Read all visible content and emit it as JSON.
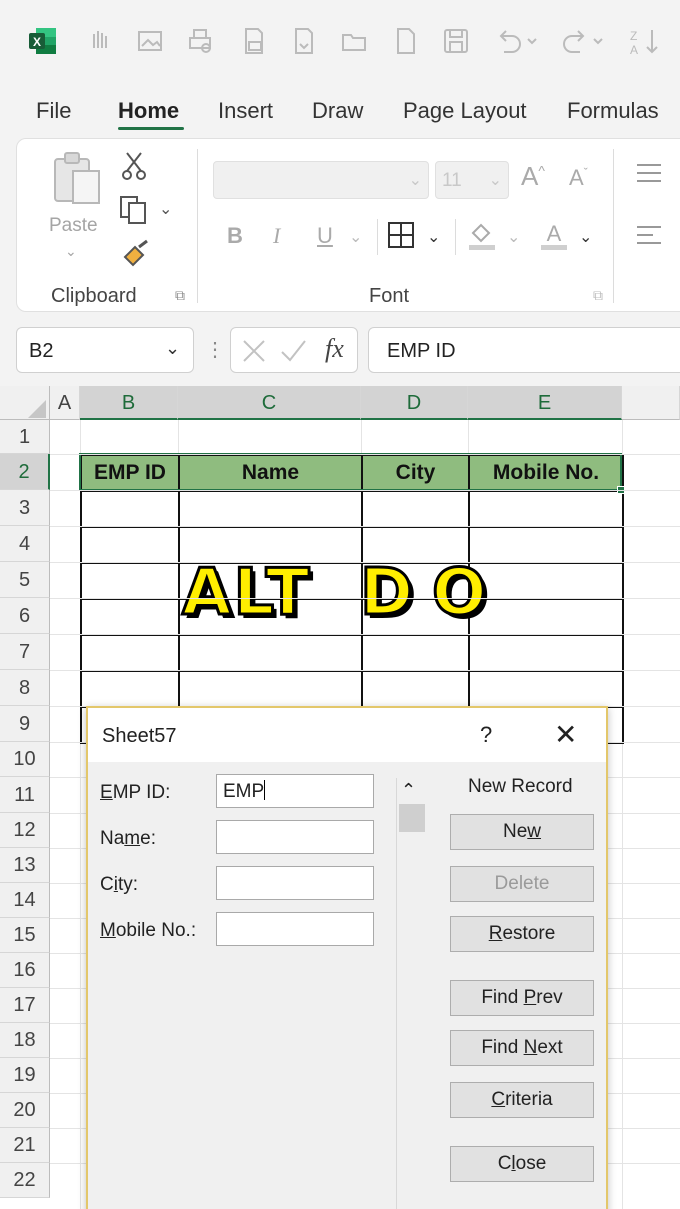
{
  "qat": {
    "icons": [
      "excel-logo",
      "touch-mode-icon",
      "image-icon",
      "print-preview-icon",
      "print-icon",
      "save-as-icon",
      "open-icon",
      "new-icon",
      "save-icon",
      "undo-icon",
      "redo-icon",
      "sort-icon"
    ]
  },
  "tabs": [
    "File",
    "Home",
    "Insert",
    "Draw",
    "Page Layout",
    "Formulas"
  ],
  "active_tab": "Home",
  "ribbon": {
    "paste_label": "Paste",
    "clipboard_label": "Clipboard",
    "font_label": "Font",
    "font_size": "11",
    "bold": "B",
    "italic": "I",
    "underline": "U"
  },
  "formula_bar": {
    "name_box": "B2",
    "fx": "fx",
    "content": "EMP ID"
  },
  "grid": {
    "columns": [
      "A",
      "B",
      "C",
      "D",
      "E"
    ],
    "rows": [
      "1",
      "2",
      "3",
      "4",
      "5",
      "6",
      "7",
      "8",
      "9",
      "10",
      "11",
      "12",
      "13",
      "14",
      "15",
      "16",
      "17",
      "18",
      "19",
      "20",
      "21",
      "22"
    ],
    "headers": [
      "EMP ID",
      "Name",
      "City",
      "Mobile No."
    ]
  },
  "overlay": {
    "left": "ALT",
    "middle": "D",
    "right": "O"
  },
  "dialog": {
    "title": "Sheet57",
    "help": "?",
    "close": "✕",
    "record_status": "New Record",
    "fields": [
      {
        "label": "EMP ID:",
        "value": "EMP"
      },
      {
        "label": "Name:",
        "value": ""
      },
      {
        "label": "City:",
        "value": ""
      },
      {
        "label": "Mobile No.:",
        "value": ""
      }
    ],
    "buttons": [
      "New",
      "Delete",
      "Restore",
      "Find Prev",
      "Find Next",
      "Criteria",
      "Close"
    ]
  },
  "colors": {
    "accent": "#217346",
    "header_fill": "#8fbc7f",
    "overlay_fill": "#ffee00"
  }
}
